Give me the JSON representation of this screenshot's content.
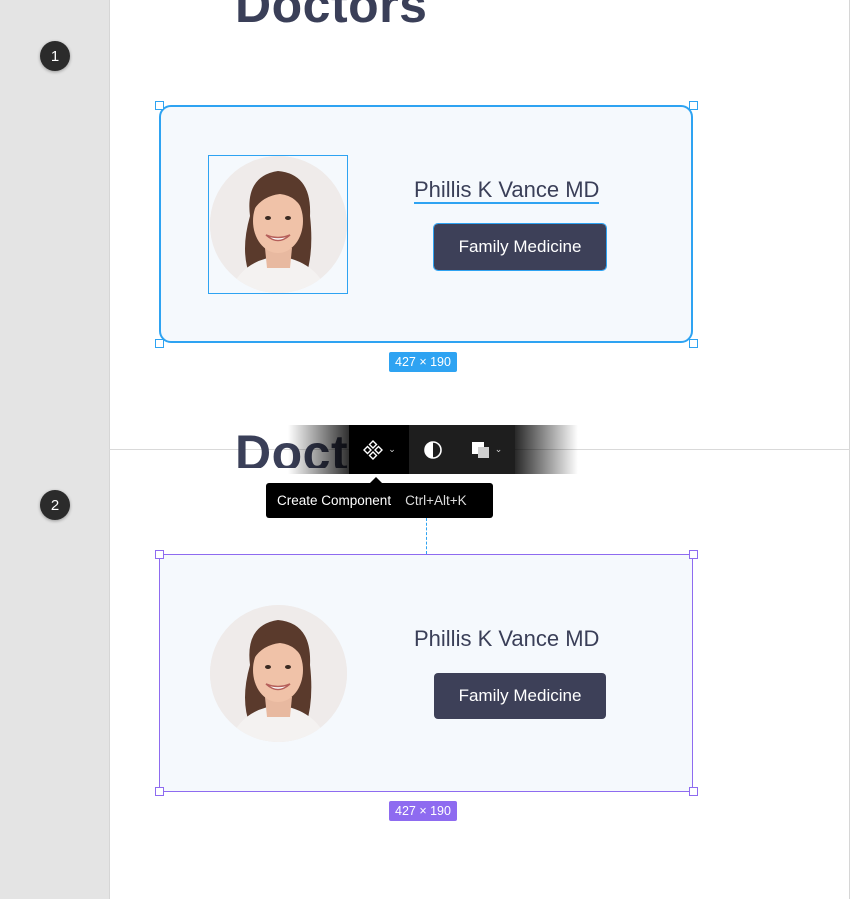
{
  "steps": [
    "1",
    "2"
  ],
  "heading": "Doctors",
  "card": {
    "doctor_name": "Phillis K Vance MD",
    "specialty": "Family Medicine"
  },
  "dimensions_label": "427 × 190",
  "toolbar": {
    "items": [
      {
        "name": "create-component",
        "icon": "component-icon",
        "has_dropdown": true,
        "active": true
      },
      {
        "name": "mask",
        "icon": "mask-icon",
        "has_dropdown": false
      },
      {
        "name": "boolean",
        "icon": "boolean-union-icon",
        "has_dropdown": true
      }
    ]
  },
  "tooltip": {
    "label": "Create Component",
    "shortcut": "Ctrl+Alt+K"
  },
  "colors": {
    "selection_blue": "#2ea3f2",
    "component_purple": "#8e6bf0",
    "button_dark": "#3d4058",
    "card_bg": "#f5f9fd"
  }
}
